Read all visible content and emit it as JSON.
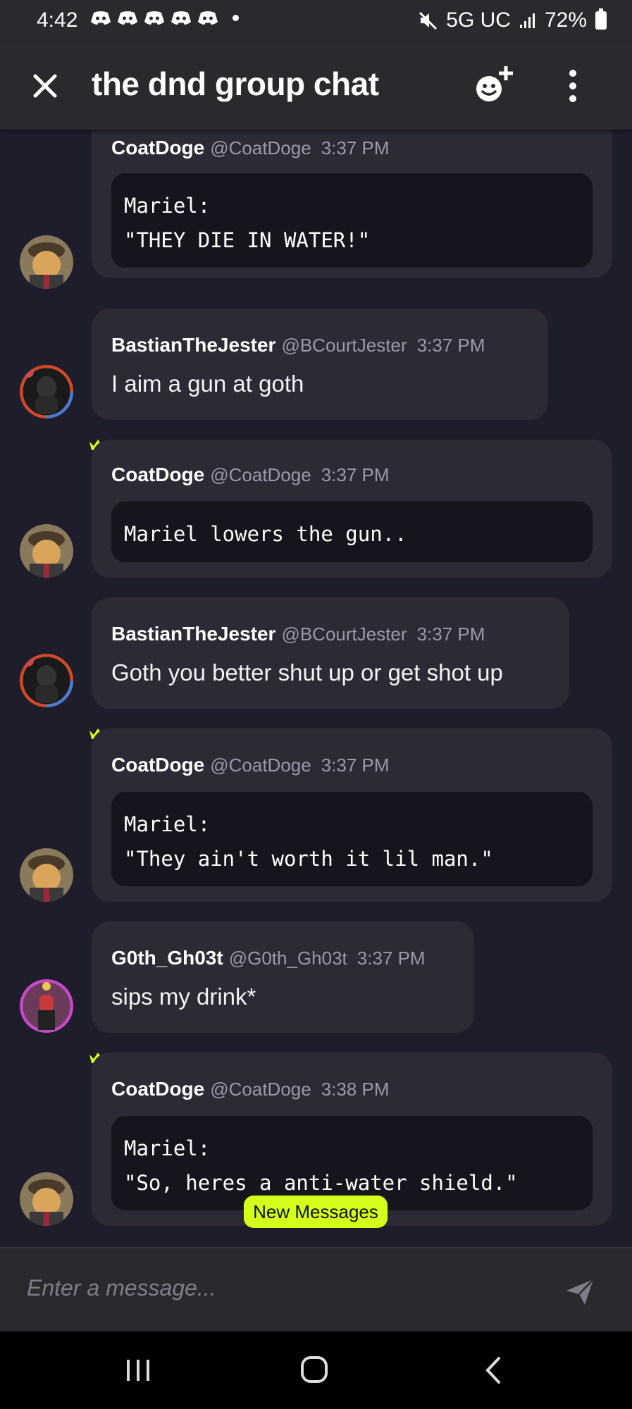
{
  "status_bar": {
    "time": "4:42",
    "network": "5G UC",
    "battery": "72%"
  },
  "header": {
    "title": "the dnd group chat",
    "close_icon": "close-icon",
    "add_reaction_icon": "emoji-add-icon",
    "more_icon": "more-vertical-icon"
  },
  "messages": [
    {
      "name": "CoatDoge",
      "handle": "@CoatDoge",
      "time": "3:37 PM",
      "lines": [
        "Mariel:",
        "\"THEY DIE IN WATER!\""
      ]
    },
    {
      "name": "BastianTheJester",
      "handle": "@BCourtJester",
      "time": "3:37 PM",
      "text": "I aim a gun at goth"
    },
    {
      "name": "CoatDoge",
      "handle": "@CoatDoge",
      "time": "3:37 PM",
      "lines": [
        "Mariel lowers the gun.."
      ]
    },
    {
      "name": "BastianTheJester",
      "handle": "@BCourtJester",
      "time": "3:37 PM",
      "text": "Goth you better shut up or get shot up"
    },
    {
      "name": "CoatDoge",
      "handle": "@CoatDoge",
      "time": "3:37 PM",
      "lines": [
        "Mariel:",
        "\"They ain't worth it lil man.\""
      ]
    },
    {
      "name": "G0th_Gh03t",
      "handle": "@G0th_Gh03t",
      "time": "3:37 PM",
      "text": "sips my drink*"
    },
    {
      "name": "CoatDoge",
      "handle": "@CoatDoge",
      "time": "3:38 PM",
      "lines": [
        "Mariel:",
        "\"So, heres a anti-water shield.\""
      ]
    }
  ],
  "new_messages_label": "New Messages",
  "input": {
    "placeholder": "Enter a message...",
    "send_icon": "send-icon"
  },
  "nav": {
    "recent_icon": "recent-apps-icon",
    "home_icon": "home-icon",
    "back_icon": "back-icon"
  },
  "colors": {
    "background": "#1e1d2c",
    "bubble": "#2b2a35",
    "code_block": "#16151e",
    "accent": "#d4ff1a"
  }
}
